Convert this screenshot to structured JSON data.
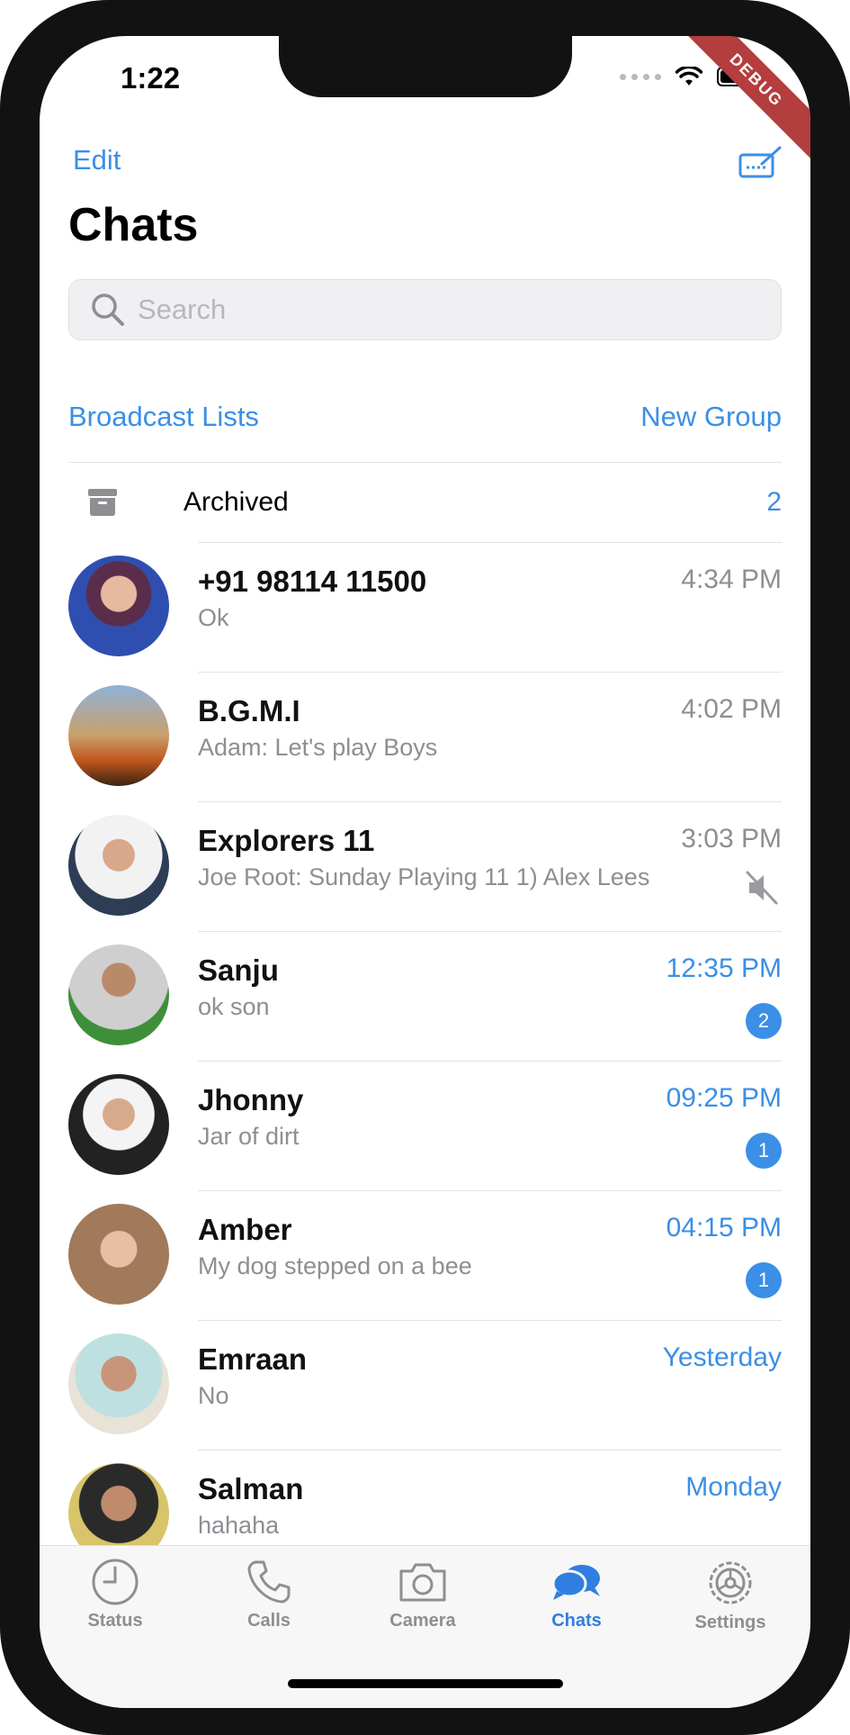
{
  "status_bar": {
    "time": "1:22",
    "debug_label": "DEBUG"
  },
  "header": {
    "edit_label": "Edit",
    "title": "Chats"
  },
  "search": {
    "placeholder": "Search"
  },
  "actions": {
    "broadcast_label": "Broadcast Lists",
    "new_group_label": "New Group"
  },
  "archived": {
    "label": "Archived",
    "count": "2"
  },
  "chats": [
    {
      "name": "+91 98114 11500",
      "message": "Ok",
      "time": "4:34 PM",
      "unread": "",
      "muted": false,
      "avatar_color": "#3a4a8a"
    },
    {
      "name": "B.G.M.I",
      "message": "Adam: Let's play Boys",
      "time": "4:02 PM",
      "unread": "",
      "muted": false,
      "avatar_color": "#b86a2a"
    },
    {
      "name": "Explorers 11",
      "message": "Joe Root: Sunday Playing 11 1) Alex Lees",
      "time": "3:03 PM",
      "unread": "",
      "muted": true,
      "avatar_color": "#2c3d55"
    },
    {
      "name": "Sanju",
      "message": "ok son",
      "time": "12:35 PM",
      "unread": "2",
      "muted": false,
      "avatar_color": "#3f8f3a"
    },
    {
      "name": "Jhonny",
      "message": "Jar of dirt",
      "time": "09:25 PM",
      "unread": "1",
      "muted": false,
      "avatar_color": "#3a3a3a"
    },
    {
      "name": "Amber",
      "message": "My dog stepped on a bee",
      "time": "04:15 PM",
      "unread": "1",
      "muted": false,
      "avatar_color": "#a07a5a"
    },
    {
      "name": "Emraan",
      "message": "No",
      "time": "Yesterday",
      "unread": "",
      "muted": false,
      "avatar_color": "#c9b79a"
    },
    {
      "name": "Salman",
      "message": "hahaha",
      "time": "Monday",
      "unread": "",
      "muted": false,
      "avatar_color": "#d8c56a"
    }
  ],
  "tabbar": {
    "tabs": [
      {
        "label": "Status",
        "icon": "clock-icon"
      },
      {
        "label": "Calls",
        "icon": "phone-icon"
      },
      {
        "label": "Camera",
        "icon": "camera-icon"
      },
      {
        "label": "Chats",
        "icon": "chat-bubbles-icon"
      },
      {
        "label": "Settings",
        "icon": "gear-icon"
      }
    ],
    "active": "Chats"
  },
  "colors": {
    "accent": "#3b8fe6",
    "muted_text": "#8e8e93",
    "debug_banner": "#b43d3d"
  }
}
